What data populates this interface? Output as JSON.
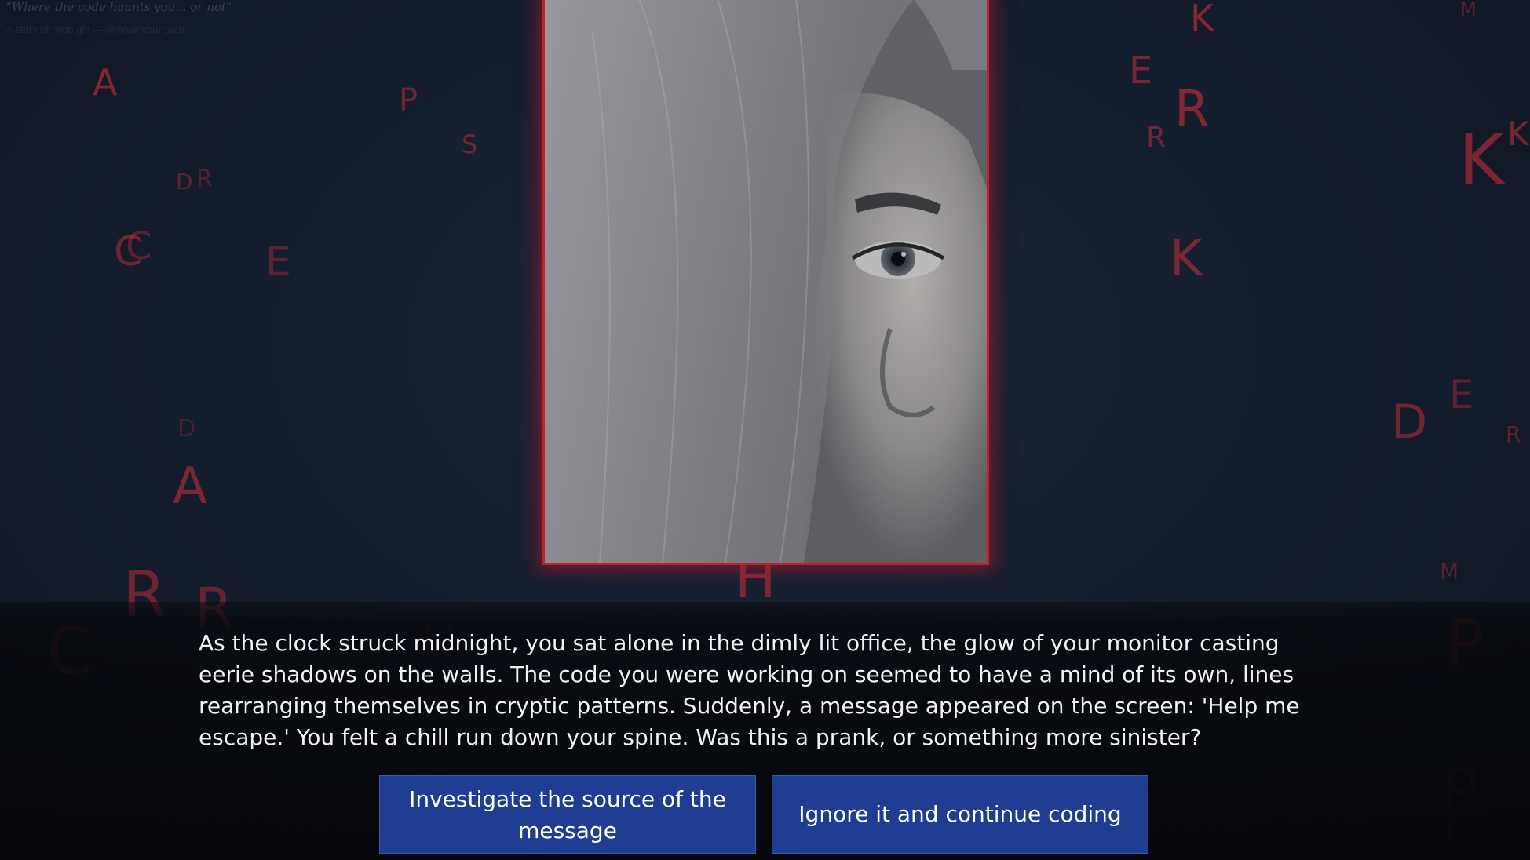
{
  "game": {
    "tagline": "\"Where the code haunts you... or not\"",
    "subline": "A story of midnight — choose your path"
  },
  "scene": {
    "image_alt": "Pale face partially hidden behind a grey veil, one eye staring",
    "frame_color": "#c3202c"
  },
  "story": {
    "text": "As the clock struck midnight, you sat alone in the dimly lit office, the glow of your monitor casting eerie shadows on the walls. The code you were working on seemed to have a mind of its own, lines rearranging themselves in cryptic patterns. Suddenly, a message appeared on the screen: 'Help me escape.' You felt a chill run down your spine. Was this a prank, or something more sinister?"
  },
  "choices": [
    {
      "label": "Investigate the source of the message"
    },
    {
      "label": "Ignore it and continue coding"
    }
  ],
  "colors": {
    "background": "#141d2c",
    "glyph": "#e0303d",
    "button": "#1f3e93",
    "text": "#f2f2f4"
  },
  "background_glyphs": [
    "A",
    "P",
    "S",
    "D",
    "R",
    "C",
    "C",
    "E",
    "D",
    "A",
    "R",
    "R",
    "C",
    "H",
    "K",
    "E",
    "R",
    "R",
    "K",
    "M",
    "K",
    "K",
    "D",
    "E",
    "R",
    "M",
    "P",
    "R",
    "C",
    "H"
  ]
}
